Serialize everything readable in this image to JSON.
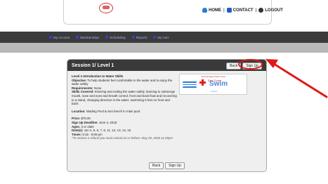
{
  "header": {
    "home_label": "HOME",
    "contact_label": "CONTACT",
    "logout_label": "LOGOUT",
    "separator": "|"
  },
  "nav": {
    "items": [
      "My Account",
      "Memberships",
      "Scheduling",
      "Reports",
      "My Cart"
    ]
  },
  "session": {
    "title": "Session 1/ Level 1",
    "back_label": "Back",
    "signup_label": "Sign Up",
    "description_title": "Level 1-Introduction to Water Skills",
    "objective_label": "Objective:",
    "objective_text": "To help students feel comfortable in the water and to enjoy the water safely",
    "requirements_label": "Requirements:",
    "requirements_text": "None",
    "skills_label": "Skills Covered:",
    "skills_text": "Entering and exiting the water safely, learning to submerge mouth, nose and eyes and breath control, front and back float and recovering to a stand, changing direction in the water, swimming 5 feet on front and back.",
    "location_label": "Location:",
    "location_text": "Wading Pool & Sun bench in main pool.",
    "price_label": "Price:",
    "price_text": "$75.00",
    "deadline_label": "Sign Up Deadline:",
    "deadline_text": "June 4, 2018",
    "ages_label": "Ages:",
    "ages_text": "3 or older",
    "dates_label": "Date(s):",
    "dates_text": "Jun 4, 5, 6, 7, 8, 11, 12, 13, 14, 15",
    "times_label": "Times:",
    "times_text": "5:15 - 6:00 pm",
    "refund_note": "*To receive a refund you must cancel on or before: May 28, 2018 11:45pm",
    "logo": {
      "top_text": "North England Swim Club",
      "org_text": "Red Cross",
      "swim_text": "Swim",
      "level_text": "Level 1"
    }
  },
  "colors": {
    "highlight": "#e01818",
    "nav_link": "#9fb4ff",
    "panel_header": "#3a3a3a"
  }
}
